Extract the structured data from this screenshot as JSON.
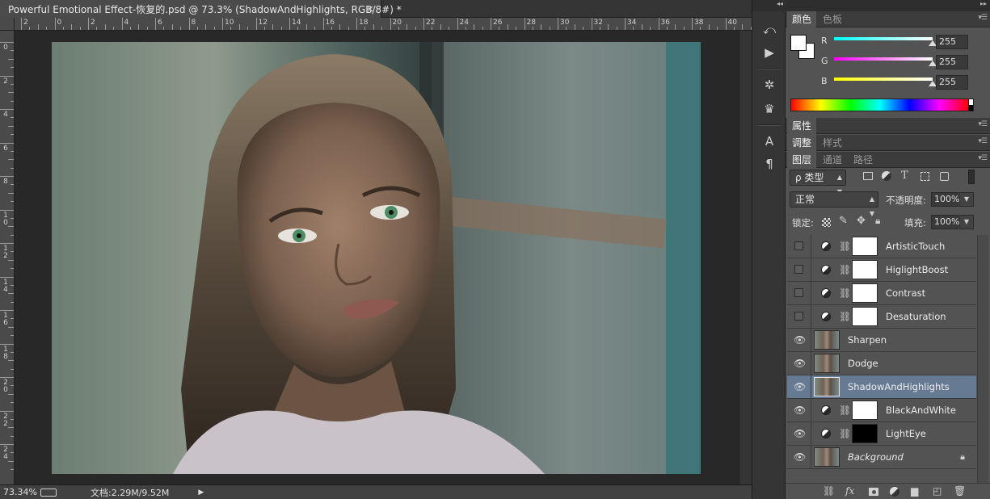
{
  "document": {
    "tab_title": "Powerful Emotional Effect-恢复的.psd @ 73.3% (ShadowAndHighlights, RGB/8#) *",
    "close_glyph": "×"
  },
  "ruler": {
    "top_labels": [
      "2",
      "0",
      "2",
      "4",
      "6",
      "8",
      "10",
      "12",
      "14",
      "16",
      "18",
      "20",
      "22",
      "24",
      "26",
      "28",
      "30",
      "32",
      "34",
      "36",
      "38",
      "40"
    ],
    "left_labels": [
      "0",
      "2",
      "4",
      "6",
      "8",
      "10",
      "12",
      "14",
      "16",
      "18",
      "20",
      "22",
      "24"
    ]
  },
  "status": {
    "zoom": "73.34%",
    "doc_size": "文档:2.29M/9.52M"
  },
  "panel_collapse": "◂◂",
  "panel_expand": "▸▸",
  "color_panel": {
    "tabs": [
      "颜色",
      "色板"
    ],
    "channels": [
      {
        "label": "R",
        "value": "255",
        "color": "#00ffff"
      },
      {
        "label": "G",
        "value": "255",
        "color": "#ff00ff"
      },
      {
        "label": "B",
        "value": "255",
        "color": "#ffff00"
      }
    ]
  },
  "properties_panel": {
    "tabs": [
      "属性"
    ]
  },
  "adjust_panel": {
    "tabs": [
      "调整",
      "样式"
    ]
  },
  "layers_panel": {
    "tabs": [
      "图层",
      "通道",
      "路径"
    ],
    "filter_kind": "ρ 类型",
    "blend_mode": "正常",
    "opacity_label": "不透明度:",
    "opacity_value": "100%",
    "lock_label": "锁定:",
    "fill_label": "填充:",
    "fill_value": "100%",
    "layers": [
      {
        "name": "ArtisticTouch",
        "visible": false,
        "type": "adjustment"
      },
      {
        "name": "HiglightBoost",
        "visible": false,
        "type": "adjustment"
      },
      {
        "name": "Contrast",
        "visible": false,
        "type": "adjustment"
      },
      {
        "name": "Desaturation",
        "visible": false,
        "type": "adjustment"
      },
      {
        "name": "Sharpen",
        "visible": true,
        "type": "pixel"
      },
      {
        "name": "Dodge",
        "visible": true,
        "type": "pixel"
      },
      {
        "name": "ShadowAndHighlights",
        "visible": true,
        "type": "pixel",
        "selected": true
      },
      {
        "name": "BlackAndWhite",
        "visible": true,
        "type": "adjustment"
      },
      {
        "name": "LightEye",
        "visible": true,
        "type": "adjustment",
        "mask": "black"
      },
      {
        "name": "Background",
        "visible": true,
        "type": "background",
        "locked": true
      }
    ]
  },
  "colors": {
    "selected_layer": "#667a94",
    "panel_bg": "#535353"
  }
}
